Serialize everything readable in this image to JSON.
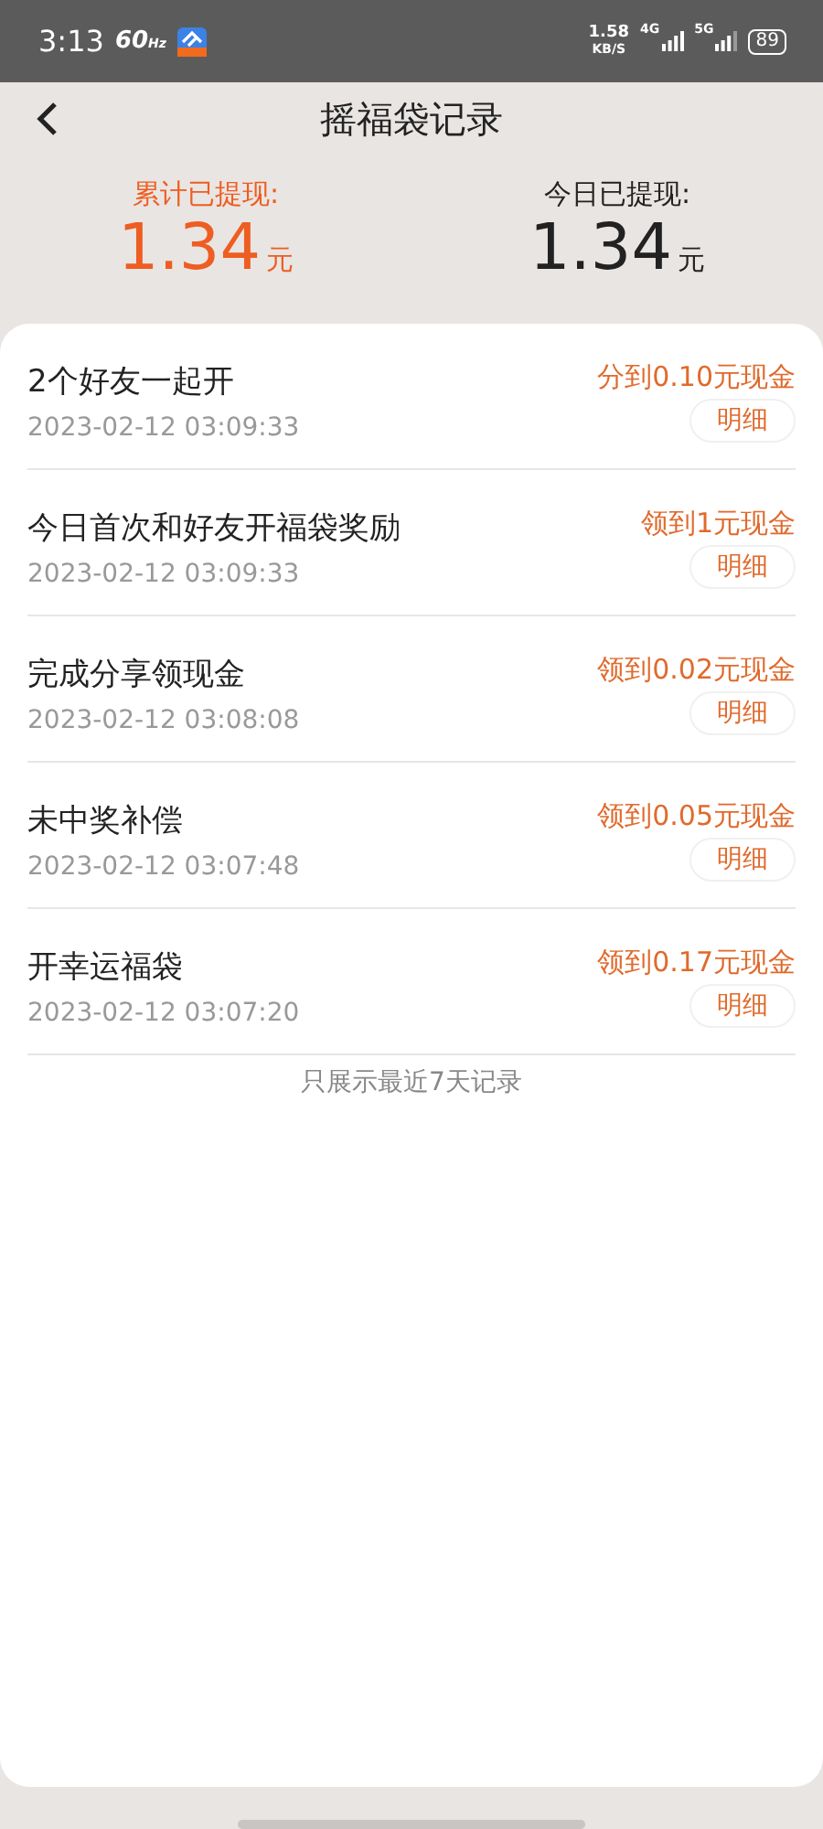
{
  "status_bar": {
    "time": "3:13",
    "refresh_rate": "60",
    "refresh_unit": "Hz",
    "net_speed": "1.58",
    "net_unit": "KB/S",
    "network_1": "4G",
    "network_2": "5G",
    "battery": "89"
  },
  "header": {
    "title": "摇福袋记录"
  },
  "summary": [
    {
      "label": "累计已提现:",
      "amount": "1.34",
      "unit": "元",
      "highlight": true
    },
    {
      "label": "今日已提现:",
      "amount": "1.34",
      "unit": "元",
      "highlight": false
    }
  ],
  "records": [
    {
      "title": "2个好友一起开",
      "time": "2023-02-12 03:09:33",
      "reward": "分到0.10元现金",
      "button": "明细"
    },
    {
      "title": "今日首次和好友开福袋奖励",
      "time": "2023-02-12 03:09:33",
      "reward": "领到1元现金",
      "button": "明细"
    },
    {
      "title": "完成分享领现金",
      "time": "2023-02-12 03:08:08",
      "reward": "领到0.02元现金",
      "button": "明细"
    },
    {
      "title": "未中奖补偿",
      "time": "2023-02-12 03:07:48",
      "reward": "领到0.05元现金",
      "button": "明细"
    },
    {
      "title": "开幸运福袋",
      "time": "2023-02-12 03:07:20",
      "reward": "领到0.17元现金",
      "button": "明细"
    }
  ],
  "footer_note": "只展示最近7天记录"
}
